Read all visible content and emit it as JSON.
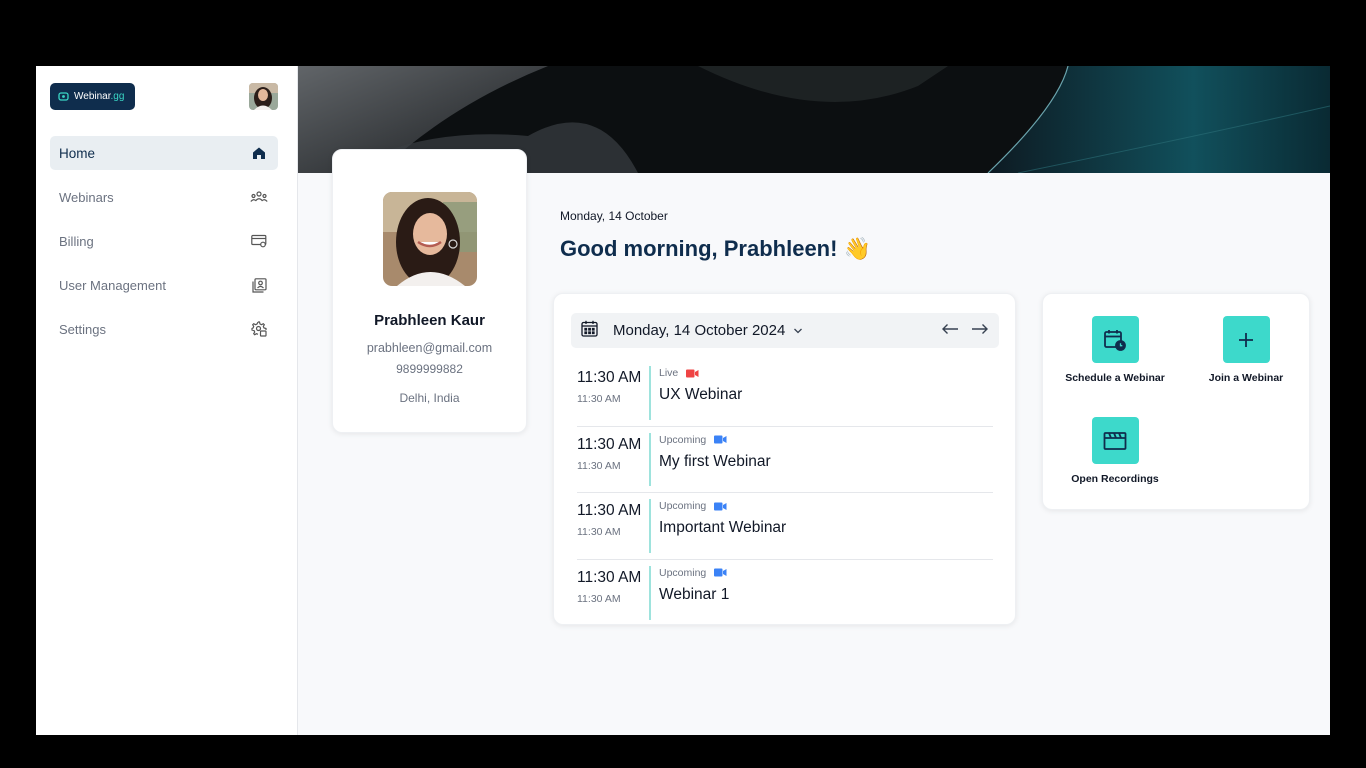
{
  "sidebar": {
    "logo": {
      "main": "Webinar",
      "accent": ".gg"
    },
    "items": [
      {
        "label": "Home",
        "icon": "home-icon",
        "active": true
      },
      {
        "label": "Webinars",
        "icon": "group-icon",
        "active": false
      },
      {
        "label": "Billing",
        "icon": "billing-card-icon",
        "active": false
      },
      {
        "label": "User Management",
        "icon": "user-profile-icon",
        "active": false
      },
      {
        "label": "Settings",
        "icon": "gear-icon",
        "active": false
      }
    ]
  },
  "profile": {
    "name": "Prabhleen Kaur",
    "email": "prabhleen@gmail.com",
    "phone": "9899999882",
    "location": "Delhi, India"
  },
  "header": {
    "date": "Monday, 14 October",
    "greeting": "Good morning, Prabhleen!",
    "greeting_emoji": "👋"
  },
  "schedule": {
    "selected_date": "Monday, 14 October 2024",
    "events": [
      {
        "time": "11:30 AM",
        "sub_time": "11:30 AM",
        "status": "Live",
        "title": "UX Webinar",
        "status_color": "#ef4444"
      },
      {
        "time": "11:30 AM",
        "sub_time": "11:30 AM",
        "status": "Upcoming",
        "title": "My first Webinar",
        "status_color": "#3b82f6"
      },
      {
        "time": "11:30 AM",
        "sub_time": "11:30 AM",
        "status": "Upcoming",
        "title": "Important Webinar",
        "status_color": "#3b82f6"
      },
      {
        "time": "11:30 AM",
        "sub_time": "11:30 AM",
        "status": "Upcoming",
        "title": "Webinar 1",
        "status_color": "#3b82f6"
      }
    ]
  },
  "actions": {
    "schedule_label": "Schedule a Webinar",
    "join_label": "Join a Webinar",
    "recordings_label": "Open Recordings"
  },
  "colors": {
    "brand_navy": "#0f2d4d",
    "accent_teal": "#3dd9cb",
    "live_red": "#ef4444",
    "upcoming_blue": "#3b82f6"
  }
}
